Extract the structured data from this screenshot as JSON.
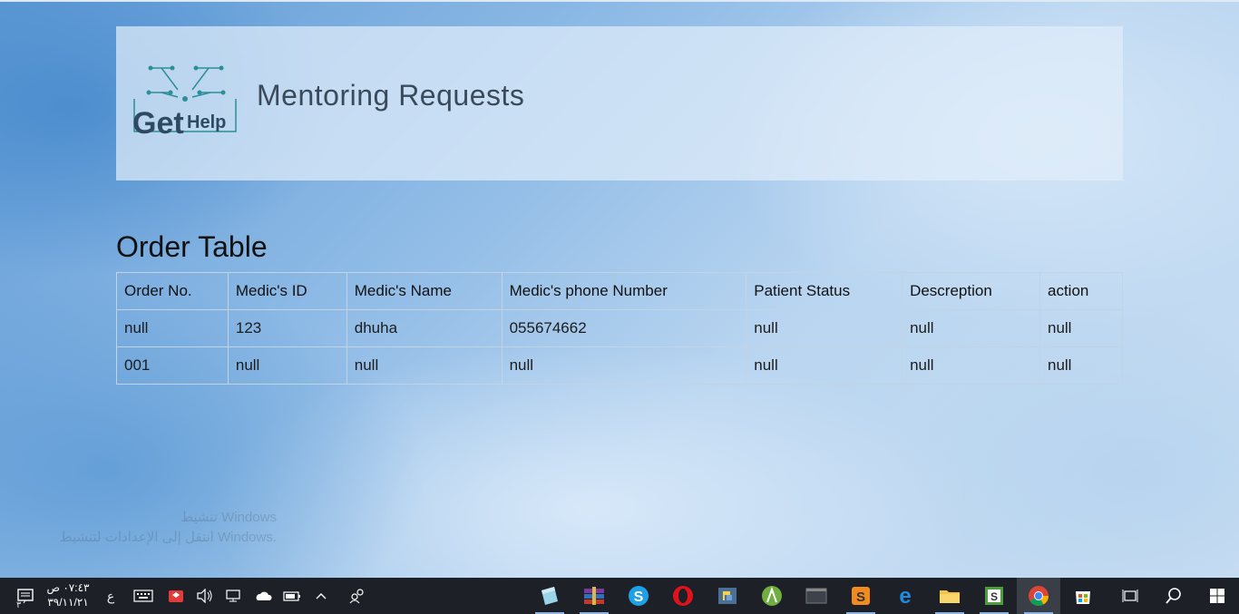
{
  "header": {
    "logo_text_main": "Get",
    "logo_text_sub": "Help",
    "title": "Mentoring Requests"
  },
  "section": {
    "title": "Order Table"
  },
  "table": {
    "columns": [
      "Order No.",
      "Medic's ID",
      "Medic's Name",
      "Medic's phone Number",
      "Patient Status",
      "Descreption",
      "action"
    ],
    "rows": [
      [
        "null",
        "123",
        "dhuha",
        "055674662",
        "null",
        "null",
        "null"
      ],
      [
        "001",
        "null",
        "null",
        "null",
        "null",
        "null",
        "null"
      ]
    ]
  },
  "watermark": {
    "line1": "تنشيط Windows",
    "line2": "انتقل إلى الإعدادات لتنشيط Windows."
  },
  "taskbar": {
    "clock_time": "٠٧:٤٣ ص",
    "clock_date": "٣٩/١١/٢١",
    "language": "ع",
    "notification_count": "٣",
    "apps": [
      {
        "name": "notepad"
      },
      {
        "name": "winrar"
      },
      {
        "name": "skype"
      },
      {
        "name": "opera"
      },
      {
        "name": "python"
      },
      {
        "name": "android-studio"
      },
      {
        "name": "terminal"
      },
      {
        "name": "sublime"
      },
      {
        "name": "edge"
      },
      {
        "name": "file-explorer"
      },
      {
        "name": "sourcetree"
      },
      {
        "name": "chrome"
      },
      {
        "name": "store"
      }
    ]
  },
  "colors": {
    "taskbar_bg": "#1d2127",
    "header_panel": "#e1edf9",
    "table_border": "#c2d3e4"
  }
}
